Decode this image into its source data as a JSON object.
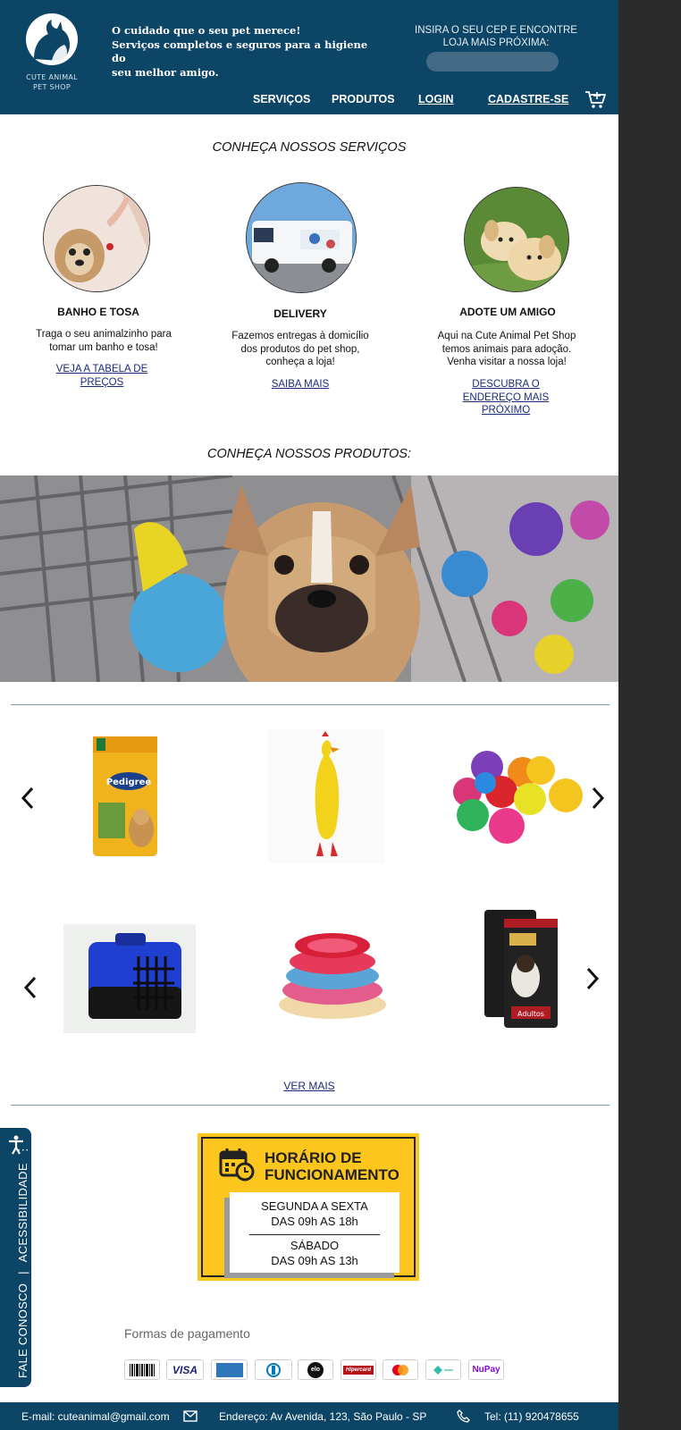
{
  "header": {
    "logo_line1": "CUTE ANIMAL",
    "logo_line2": "PET SHOP",
    "tagline_line1": "O cuidado que o seu pet merece!",
    "tagline_line2": "Serviços completos e seguros para a higiene do",
    "tagline_line3": "seu melhor amigo.",
    "cep_line1": "INSIRA O SEU CEP E ENCONTRE",
    "cep_line2": "LOJA MAIS PRÓXIMA:",
    "cep_value": "",
    "nav": {
      "servicos": "SERVIÇOS",
      "produtos": "PRODUTOS",
      "login": "LOGIN",
      "cadastre": "CADASTRE-SE"
    }
  },
  "services": {
    "title": "CONHEÇA NOSSOS SERVIÇOS",
    "items": [
      {
        "title": "BANHO E TOSA",
        "desc": [
          "Traga o seu animalzinho para",
          "tomar um banho e tosa!"
        ],
        "link": [
          "VEJA A TABELA DE",
          "PREÇOS"
        ]
      },
      {
        "title": "DELIVERY",
        "desc": [
          "Fazemos entregas à domicílio",
          "dos produtos do pet shop,",
          "conheça a loja!"
        ],
        "link": [
          "SAIBA MAIS"
        ]
      },
      {
        "title": "ADOTE UM AMIGO",
        "desc": [
          "Aqui na Cute Animal Pet Shop",
          "temos animais para adoção.",
          "Venha visitar a nossa loja!"
        ],
        "link": [
          "DESCUBRA O",
          "ENDEREÇO MAIS",
          "PRÓXIMO"
        ]
      }
    ]
  },
  "products": {
    "title": "CONHEÇA NOSSOS PRODUTOS:",
    "food_bag_label": "Pedigree",
    "food_bag2_label": "Adultos",
    "ver_mais": "VER MAIS"
  },
  "hours": {
    "title_line1": "HORÁRIO DE",
    "title_line2": "FUNCIONAMENTO",
    "weekday_line1": "SEGUNDA A SEXTA",
    "weekday_line2": "DAS 09h AS 18h",
    "saturday_line1": "SÁBADO",
    "saturday_line2": "DAS 09h AS 13h"
  },
  "payment": {
    "title": "Formas de pagamento",
    "methods": [
      "VISA",
      "elo",
      "Hipercard",
      "NuPay"
    ]
  },
  "side_tab": {
    "fale": "FALE CONOSCO",
    "access": "ACESSIBILIDADE"
  },
  "footer": {
    "email": "E-mail: cuteanimal@gmail.com",
    "address": "Endereço: Av Avenida, 123, São Paulo - SP",
    "phone": "Tel: (11) 920478655"
  },
  "colors": {
    "header_bg": "#0d4566",
    "accent_yellow": "#fdc61f",
    "link_blue": "#1a2b7a"
  }
}
